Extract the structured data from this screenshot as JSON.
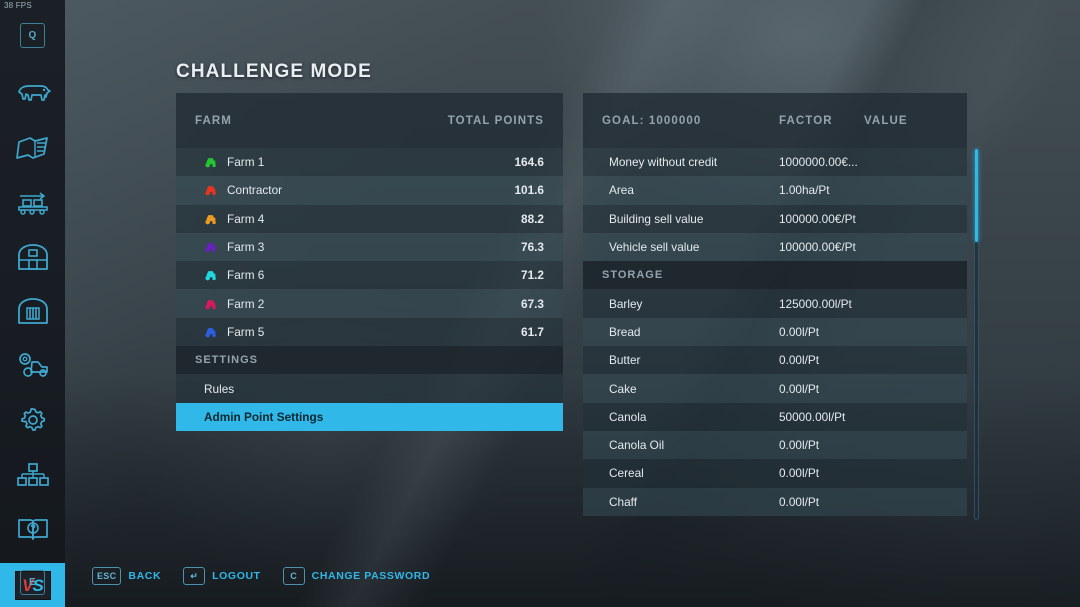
{
  "hud": {
    "fps": "38 FPS"
  },
  "page": {
    "title": "CHALLENGE MODE"
  },
  "sidebar": {
    "items": [
      {
        "name": "quit-icon",
        "label": "Q",
        "type": "key"
      },
      {
        "name": "animals-icon",
        "label": "Animals",
        "type": "icon"
      },
      {
        "name": "contracts-icon",
        "label": "Contracts",
        "type": "icon"
      },
      {
        "name": "production-icon",
        "label": "Production Chain",
        "type": "icon"
      },
      {
        "name": "farmhouse-icon",
        "label": "Farm House",
        "type": "icon"
      },
      {
        "name": "barn-icon",
        "label": "Barn",
        "type": "icon"
      },
      {
        "name": "vehicle-icon",
        "label": "Vehicles",
        "type": "icon"
      },
      {
        "name": "settings-gear-icon",
        "label": "Settings",
        "type": "icon"
      },
      {
        "name": "farms-icon",
        "label": "Farms",
        "type": "icon"
      },
      {
        "name": "help-book-icon",
        "label": "Help",
        "type": "icon"
      },
      {
        "name": "versus-icon",
        "label": "VS",
        "type": "vs",
        "active": true
      },
      {
        "name": "interact-key",
        "label": "E",
        "type": "key"
      }
    ]
  },
  "left_panel": {
    "header": {
      "farm": "FARM",
      "points": "TOTAL POINTS"
    },
    "farms": [
      {
        "name": "Farm 1",
        "points": "164.6",
        "color": "#27c432"
      },
      {
        "name": "Contractor",
        "points": "101.6",
        "color": "#e8341e"
      },
      {
        "name": "Farm 4",
        "points": "88.2",
        "color": "#eb9b20"
      },
      {
        "name": "Farm 3",
        "points": "76.3",
        "color": "#6a1fbf"
      },
      {
        "name": "Farm 6",
        "points": "71.2",
        "color": "#21d8e0"
      },
      {
        "name": "Farm 2",
        "points": "67.3",
        "color": "#d41a5c"
      },
      {
        "name": "Farm 5",
        "points": "61.7",
        "color": "#2b5fe0"
      }
    ],
    "settings_header": "SETTINGS",
    "settings": [
      {
        "label": "Rules",
        "selected": false
      },
      {
        "label": "Admin Point Settings",
        "selected": true
      }
    ]
  },
  "right_panel": {
    "header": {
      "goal": "GOAL: 1000000",
      "factor": "FACTOR",
      "value": "VALUE"
    },
    "rows": [
      {
        "name": "Money without credit",
        "factor": "1000000.00€...",
        "value": ""
      },
      {
        "name": "Area",
        "factor": "1.00ha/Pt",
        "value": ""
      },
      {
        "name": "Building sell value",
        "factor": "100000.00€/Pt",
        "value": ""
      },
      {
        "name": "Vehicle sell value",
        "factor": "100000.00€/Pt",
        "value": ""
      }
    ],
    "storage_header": "STORAGE",
    "storage": [
      {
        "name": "Barley",
        "factor": "125000.00l/Pt",
        "value": ""
      },
      {
        "name": "Bread",
        "factor": "0.00l/Pt",
        "value": ""
      },
      {
        "name": "Butter",
        "factor": "0.00l/Pt",
        "value": ""
      },
      {
        "name": "Cake",
        "factor": "0.00l/Pt",
        "value": ""
      },
      {
        "name": "Canola",
        "factor": "50000.00l/Pt",
        "value": ""
      },
      {
        "name": "Canola Oil",
        "factor": "0.00l/Pt",
        "value": ""
      },
      {
        "name": "Cereal",
        "factor": "0.00l/Pt",
        "value": ""
      },
      {
        "name": "Chaff",
        "factor": "0.00l/Pt",
        "value": ""
      }
    ],
    "scrollbar": {
      "thumb_percent": 25
    }
  },
  "help_bar": [
    {
      "key": "ESC",
      "label": "BACK",
      "name": "back-action"
    },
    {
      "key": "↵",
      "label": "LOGOUT",
      "name": "logout-action"
    },
    {
      "key": "C",
      "label": "CHANGE PASSWORD",
      "name": "change-password-action"
    }
  ],
  "theme": {
    "accent": "#2fb8e8",
    "panel_header_bg": "#222c34",
    "row_odd": "#344852",
    "row_even": "#223038",
    "text": "#e4eaee",
    "muted": "#93a4ae"
  }
}
